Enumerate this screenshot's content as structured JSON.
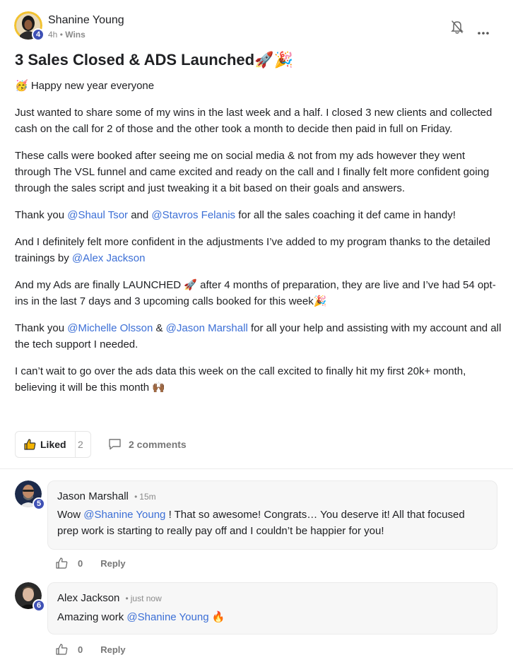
{
  "post": {
    "author": {
      "name": "Shanine Young",
      "level": "4"
    },
    "meta": {
      "time": "4h",
      "separator": "•",
      "category": "Wins"
    },
    "title": "3 Sales Closed & ADS Launched🚀🎉",
    "paragraphs": {
      "p1": "🥳 Happy new year everyone",
      "p2": "Just wanted to share some of my wins in the last week and a half. I closed 3 new clients and collected cash on the call for 2 of those and the other took a month to decide then paid in full on Friday.",
      "p3": "These calls were booked after seeing me on social media & not from my ads however they went through The VSL funnel and came excited and ready on the call and I finally felt more confident going through the sales script and just tweaking it a bit based on their goals and answers.",
      "p4": {
        "a": "Thank you ",
        "m1": "@Shaul Tsor",
        "b": " and ",
        "m2": "@Stavros Felanis",
        "c": " for all the sales coaching it def came in handy!"
      },
      "p5": {
        "a": "And I definitely felt more confident in the adjustments I’ve added to my program thanks to the detailed trainings by ",
        "m1": "@Alex Jackson"
      },
      "p6": "And my Ads are finally LAUNCHED 🚀 after 4 months of preparation, they are live and I’ve had 54 opt-ins in the last 7 days and 3 upcoming calls booked for this week🎉",
      "p7": {
        "a": "Thank you ",
        "m1": "@Michelle Olsson",
        "b": " & ",
        "m2": "@Jason Marshall",
        "c": " for all your help and assisting with my account and all the tech support I needed."
      },
      "p8": "I can’t wait to go over the ads data this week on the call excited to finally hit my first 20k+ month, believing it will be this month 🙌🏾"
    },
    "actions": {
      "like_label": "Liked",
      "like_count": "2",
      "comments_label": "2 comments"
    }
  },
  "comments": [
    {
      "name": "Jason Marshall",
      "level": "5",
      "time": "15m",
      "text": {
        "a": "Wow ",
        "m1": "@Shanine Young",
        "b": " ! That so awesome! Congrats… You deserve it! All that focused prep work is starting to really pay off and I couldn’t be happier for you!"
      },
      "likes": "0",
      "reply_label": "Reply"
    },
    {
      "name": "Alex Jackson",
      "level": "6",
      "time": "just now",
      "text": {
        "a": "Amazing work ",
        "m1": "@Shanine Young",
        "b": " 🔥"
      },
      "likes": "0",
      "reply_label": "Reply"
    }
  ],
  "colors": {
    "mention": "#3c6fd6",
    "badge": "#3f51b5",
    "bubble": "#f7f7f7"
  },
  "icons": [
    "bell-off-icon",
    "more-icon",
    "thumbs-up-icon",
    "comment-icon"
  ]
}
